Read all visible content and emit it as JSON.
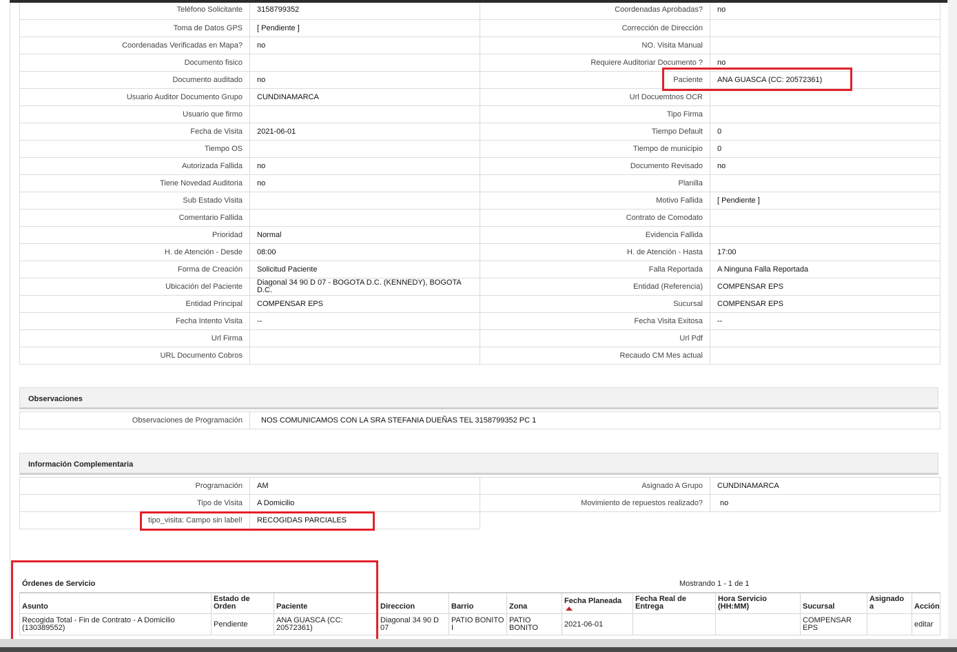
{
  "details": [
    [
      "Teléfono Solicitante",
      "3158799352",
      "Coordenadas Aprobadas?",
      "no"
    ],
    [
      "Toma de Datos GPS",
      "[ Pendiente ]",
      "Corrección de Dirección",
      ""
    ],
    [
      "Coordenadas Verificadas en Mapa?",
      "no",
      "NO. Visita Manual",
      ""
    ],
    [
      "Documento fisico",
      "",
      "Requiere Auditoriar Documento ?",
      "no"
    ],
    [
      "Documento auditado",
      "no",
      "Paciente",
      "ANA GUASCA (CC: 20572361)"
    ],
    [
      "Usuario Auditor Documento Grupo",
      "CUNDINAMARCA",
      "Url Docuemtnos OCR",
      ""
    ],
    [
      "Usuario que firmo",
      "",
      "Tipo Firma",
      ""
    ],
    [
      "Fecha de Visita",
      "2021-06-01",
      "Tiempo Default",
      "0"
    ],
    [
      "Tiempo OS",
      "",
      "Tiempo de municipio",
      "0"
    ],
    [
      "Autorizada Fallida",
      "no",
      "Documento Revisado",
      "no"
    ],
    [
      "Tiene Novedad Auditoria",
      "no",
      "Planilla",
      ""
    ],
    [
      "Sub Estado Visita",
      "",
      "Motivo Fallida",
      "[ Pendiente ]"
    ],
    [
      "Comentario Fallida",
      "",
      "Contrato de Comodato",
      ""
    ],
    [
      "Prioridad",
      "Normal",
      "Evidencia Fallida",
      ""
    ],
    [
      "H. de Atención - Desde",
      "08:00",
      "H. de Atención - Hasta",
      "17:00"
    ],
    [
      "Forma de Creación",
      "Solicitud Paciente",
      "Falla Reportada",
      "A Ninguna Falla Reportada"
    ],
    [
      "Ubicación del Paciente",
      "Diagonal 34 90 D 07 - BOGOTA D.C. (KENNEDY), BOGOTA D.C.",
      "Entidad (Referencia)",
      "COMPENSAR EPS"
    ],
    [
      "Entidad Principal",
      "COMPENSAR EPS",
      "Sucursal",
      "COMPENSAR EPS"
    ],
    [
      "Fecha Intento Visita",
      "--",
      "Fecha Visita Exitosa",
      "--"
    ],
    [
      "Url Firma",
      "",
      "Url Pdf",
      ""
    ],
    [
      "URL Documento Cobros",
      "",
      "Recaudo CM Mes actual",
      ""
    ]
  ],
  "observaciones": {
    "title": "Observaciones",
    "label": "Observaciones de Programación",
    "value": "NOS COMUNICAMOS CON LA SRA STEFANIA DUEÑAS TEL 3158799352 PC 1"
  },
  "complementaria": {
    "title": "Información Complementaria",
    "rows": [
      [
        "Programación",
        "AM",
        "Asignado A Grupo",
        "CUNDINAMARCA"
      ],
      [
        "Tipo de Visita",
        "A Domicilio",
        "Movimiento de repuestos realizado?",
        "no"
      ],
      [
        "tipo_visita: Campo sin label!",
        "RECOGIDAS PARCIALES"
      ]
    ]
  },
  "ordenes": {
    "title": "Órdenes de Servicio",
    "showing": "Mostrando 1 - 1 de 1",
    "headers": [
      "Asunto",
      "Estado de Orden",
      "Paciente",
      "Direccion",
      "Barrio",
      "Zona",
      "Fecha Planeada",
      "Fecha Real de Entrega",
      "Hora Servicio (HH:MM)",
      "Sucursal",
      "Asignado a",
      "Acción"
    ],
    "row": [
      "Recogida Total - Fin de Contrato - A Domicilio (130389552)",
      "Pendiente",
      "ANA GUASCA (CC: 20572361)",
      "Diagonal 34 90 D 07",
      "PATIO BONITO I",
      "PATIO BONITO",
      "2021-06-01",
      "",
      "",
      "COMPENSAR EPS",
      "",
      "editar"
    ]
  }
}
